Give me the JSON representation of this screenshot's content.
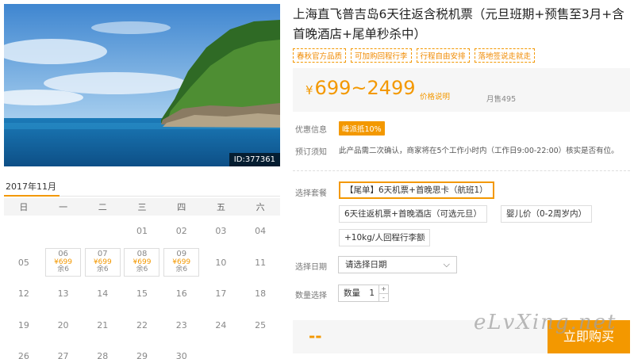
{
  "product": {
    "title": "上海直飞普吉岛6天往返含税机票（元旦班期+预售至3月+含首晚酒店+尾单秒杀中）",
    "image_id": "ID:377361",
    "tags": [
      "春秋官方品质",
      "可加购回程行李",
      "行程自由安排",
      "落地签说走就走"
    ]
  },
  "price": {
    "currency": "¥",
    "range": "699~2499",
    "note": "价格说明",
    "sold": "月售495"
  },
  "promo": {
    "label": "优惠信息",
    "badge": "峰派抵10%"
  },
  "notice": {
    "label": "预订须知",
    "text": "此产品需二次确认，商家将在5个工作小时内（工作日9:00-22:00）核实是否有位。"
  },
  "package": {
    "label": "选择套餐",
    "options": [
      "【尾单】6天机票+首晚思卡（航班1）",
      "6天往返机票+首晚酒店（可选元旦）",
      "婴儿价（0-2周岁内）",
      "+10kg/人回程行李额"
    ]
  },
  "date": {
    "label": "选择日期",
    "placeholder": "请选择日期"
  },
  "quantity": {
    "label": "数量选择",
    "prefix": "数量",
    "value": "1",
    "plus": "+",
    "minus": "-"
  },
  "buy": {
    "total": "--",
    "button": "立即购买"
  },
  "watermark": "eLvXing.net",
  "calendar": {
    "month": "2017年11月",
    "weekdays": [
      "日",
      "一",
      "二",
      "三",
      "四",
      "五",
      "六"
    ],
    "weeks": [
      [
        "",
        "",
        "",
        "01",
        "02",
        "03",
        "04"
      ],
      [
        "05",
        "06",
        "07",
        "08",
        "09",
        "10",
        "11"
      ],
      [
        "12",
        "13",
        "14",
        "15",
        "16",
        "17",
        "18"
      ],
      [
        "19",
        "20",
        "21",
        "22",
        "23",
        "24",
        "25"
      ],
      [
        "26",
        "27",
        "28",
        "29",
        "30",
        "",
        ""
      ]
    ],
    "available": {
      "06": {
        "price": "¥699",
        "remain": "余6"
      },
      "07": {
        "price": "¥699",
        "remain": "余6"
      },
      "08": {
        "price": "¥699",
        "remain": "余6"
      },
      "09": {
        "price": "¥699",
        "remain": "余6"
      }
    }
  }
}
